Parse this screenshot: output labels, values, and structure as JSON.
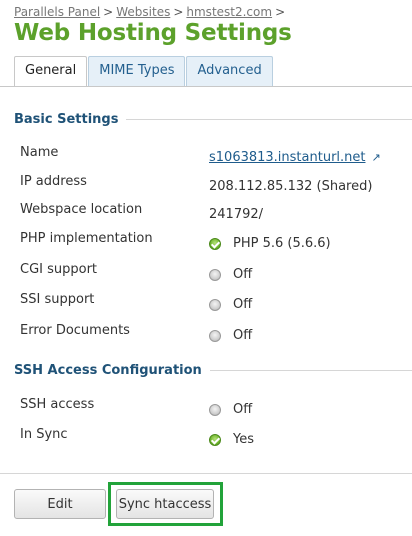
{
  "breadcrumb": {
    "items": [
      "Parallels Panel",
      "Websites",
      "hmstest2.com"
    ],
    "separator": ">"
  },
  "page_title": "Web Hosting Settings",
  "tabs": [
    {
      "label": "General",
      "active": true
    },
    {
      "label": "MIME Types",
      "active": false
    },
    {
      "label": "Advanced",
      "active": false
    }
  ],
  "sections": {
    "basic": {
      "title": "Basic Settings",
      "rows": [
        {
          "label": "Name",
          "value": "s1063813.instanturl.net"
        },
        {
          "label": "IP address",
          "value": "208.112.85.132 (Shared)"
        },
        {
          "label": "Webspace location",
          "value": "241792/"
        },
        {
          "label": "PHP implementation",
          "value": "PHP 5.6 (5.6.6)",
          "status": "on"
        },
        {
          "label": "CGI support",
          "value": "Off",
          "status": "off"
        },
        {
          "label": "SSI support",
          "value": "Off",
          "status": "off"
        },
        {
          "label": "Error Documents",
          "value": "Off",
          "status": "off"
        }
      ]
    },
    "ssh": {
      "title": "SSH Access Configuration",
      "rows": [
        {
          "label": "SSH access",
          "value": "Off",
          "status": "off"
        },
        {
          "label": "In Sync",
          "value": "Yes",
          "status": "on"
        }
      ]
    }
  },
  "buttons": {
    "edit": "Edit",
    "sync": "Sync htaccess"
  },
  "colors": {
    "title_green": "#5ca12b",
    "section_blue": "#1f5277",
    "highlight_green": "#22a33a"
  },
  "icons": {
    "status_on": "green-check-icon",
    "status_off": "grey-dot-icon",
    "external_link": "external-link-icon"
  }
}
